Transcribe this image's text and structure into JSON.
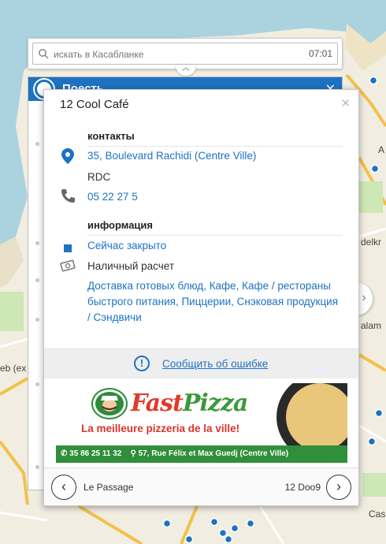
{
  "map": {
    "labels": [
      "eb (ex",
      "delkr",
      "alam",
      "Cas",
      "A"
    ]
  },
  "search": {
    "placeholder": "искать в Касабланке",
    "time": "07:01"
  },
  "back_panel": {
    "title": "Поесть"
  },
  "card": {
    "title": "12 Cool Café",
    "contacts": {
      "heading": "контакты",
      "address": "35, Boulevard Rachidi (Centre Ville)",
      "floor": "RDC",
      "phone": "05 22 27 5"
    },
    "info": {
      "heading": "информация",
      "status": "Сейчас закрыто",
      "payment": "Наличный расчет",
      "categories_line1": "Доставка готовых блюд, Кафе, Кафе / рестораны",
      "categories_line2": "быстрого питания, Пиццерии, Снэковая продукция",
      "categories_line3": "/ Сэндвичи"
    },
    "report_link": "Сообщить об ошибке",
    "ad": {
      "brand_fast": "Fast",
      "brand_pizza": "Pizza",
      "tagline": "La meilleure pizzeria de la ville!",
      "phone": "35 86 25 11 32",
      "address": "57, Rue Félix et Max Guedj (Centre Ville)"
    },
    "nav": {
      "prev_label": "Le Passage",
      "next_label": "12 Doo9"
    }
  },
  "colors": {
    "accent": "#1d72c2",
    "ad_green": "#2f8f3a",
    "ad_red": "#d9342b"
  }
}
